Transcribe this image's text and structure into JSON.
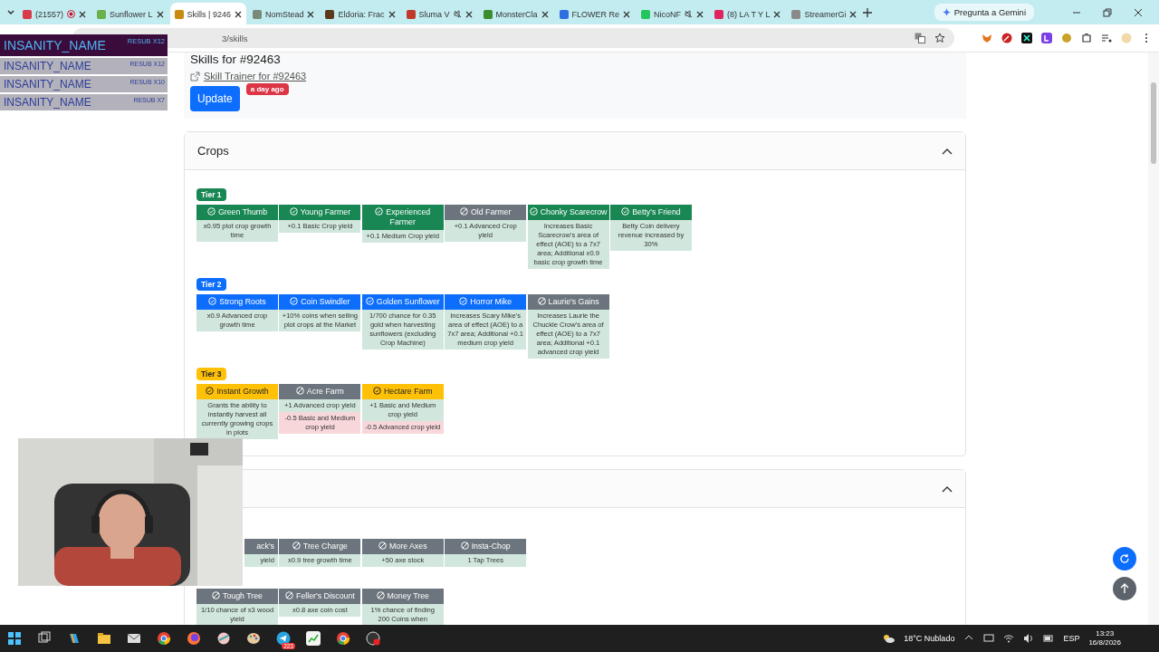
{
  "browser": {
    "tabs": [
      {
        "title": "(21557)",
        "selected": false,
        "color": "#d93a4a",
        "recording": true,
        "muted": false
      },
      {
        "title": "Sunflower L",
        "selected": false,
        "color": "#6ab04c",
        "recording": false,
        "muted": false
      },
      {
        "title": "Skills | 9246",
        "selected": true,
        "color": "#c98a10",
        "recording": false,
        "muted": false
      },
      {
        "title": "NomStead",
        "selected": false,
        "color": "#7a8a7a",
        "recording": false,
        "muted": false
      },
      {
        "title": "Eldoria: Frac",
        "selected": false,
        "color": "#5a3a1a",
        "recording": false,
        "muted": false
      },
      {
        "title": "Sluma V",
        "selected": false,
        "color": "#c0392b",
        "recording": false,
        "muted": true
      },
      {
        "title": "MonsterCla",
        "selected": false,
        "color": "#3c8d2f",
        "recording": false,
        "muted": false
      },
      {
        "title": "FLOWER Re",
        "selected": false,
        "color": "#2f6fe0",
        "recording": false,
        "muted": false
      },
      {
        "title": "NicoNF",
        "selected": false,
        "color": "#22c55e",
        "recording": false,
        "muted": true
      },
      {
        "title": "(8) LA T Y L",
        "selected": false,
        "color": "#e0245e",
        "recording": false,
        "muted": false
      },
      {
        "title": "StreamerGi",
        "selected": false,
        "color": "#8a8a8a",
        "recording": false,
        "muted": false
      }
    ],
    "gemini_button": "Pregunta a Gemini",
    "address": "3/skills"
  },
  "overlay": {
    "rows": [
      {
        "name": "INSANITY_NAME",
        "note": "RESUB X12",
        "highlighted": true
      },
      {
        "name": "INSANITY_NAME",
        "note": "RESUB X12",
        "highlighted": false
      },
      {
        "name": "INSANITY_NAME",
        "note": "RESUB X10",
        "highlighted": false
      },
      {
        "name": "INSANITY_NAME",
        "note": "RESUB X7",
        "highlighted": false
      }
    ]
  },
  "page": {
    "heading": "Skills for #92463",
    "trainer_link": "Skill Trainer for #92463",
    "update_button": "Update",
    "updated_badge": "a day ago",
    "sections": [
      {
        "title": "Crops",
        "expanded": true,
        "tiers": [
          {
            "label": "Tier 1",
            "color": "#198754",
            "skills": [
              {
                "name": "Green Thumb",
                "acquired": true,
                "effects": [
                  {
                    "text": "x0.95 plot crop growth time",
                    "kind": "buff"
                  }
                ]
              },
              {
                "name": "Young Farmer",
                "acquired": true,
                "effects": [
                  {
                    "text": "+0.1 Basic Crop yield",
                    "kind": "buff"
                  }
                ]
              },
              {
                "name": "Experienced Farmer",
                "acquired": true,
                "effects": [
                  {
                    "text": "+0.1 Medium Crop yield",
                    "kind": "buff"
                  }
                ]
              },
              {
                "name": "Old Farmer",
                "acquired": false,
                "effects": [
                  {
                    "text": "+0.1 Advanced Crop yield",
                    "kind": "buff"
                  }
                ]
              },
              {
                "name": "Chonky Scarecrow",
                "acquired": true,
                "effects": [
                  {
                    "text": "Increases Basic Scarecrow's area of effect (AOE) to a 7x7 area; Additional x0.9 basic crop growth time",
                    "kind": "buff"
                  }
                ]
              },
              {
                "name": "Betty's Friend",
                "acquired": true,
                "effects": [
                  {
                    "text": "Betty Coin delivery revenue increased by 30%",
                    "kind": "buff"
                  }
                ]
              }
            ]
          },
          {
            "label": "Tier 2",
            "color": "#0d6efd",
            "skills": [
              {
                "name": "Strong Roots",
                "acquired": true,
                "effects": [
                  {
                    "text": "x0.9 Advanced crop growth time",
                    "kind": "buff"
                  }
                ]
              },
              {
                "name": "Coin Swindler",
                "acquired": true,
                "effects": [
                  {
                    "text": "+10% coins when selling plot crops at the Market",
                    "kind": "buff"
                  }
                ]
              },
              {
                "name": "Golden Sunflower",
                "acquired": true,
                "effects": [
                  {
                    "text": "1/700 chance for 0.35 gold when harvesting sunflowers (excluding Crop Machine)",
                    "kind": "buff"
                  }
                ]
              },
              {
                "name": "Horror Mike",
                "acquired": true,
                "effects": [
                  {
                    "text": "Increases Scary Mike's area of effect (AOE) to a 7x7 area; Additional +0.1 medium crop yield",
                    "kind": "buff"
                  }
                ]
              },
              {
                "name": "Laurie's Gains",
                "acquired": false,
                "effects": [
                  {
                    "text": "Increases Laurie the Chuckle Crow's area of effect (AOE) to a 7x7 area; Additional +0.1 advanced crop yield",
                    "kind": "buff"
                  }
                ]
              }
            ]
          },
          {
            "label": "Tier 3",
            "color": "#ffc107",
            "skills": [
              {
                "name": "Instant Growth",
                "acquired": true,
                "effects": [
                  {
                    "text": "Grants the ability to instantly harvest all currently growing crops in plots",
                    "kind": "buff"
                  }
                ]
              },
              {
                "name": "Acre Farm",
                "acquired": false,
                "effects": [
                  {
                    "text": "+1 Advanced crop yield",
                    "kind": "buff"
                  },
                  {
                    "text": "-0.5 Basic and Medium crop yield",
                    "kind": "debuff"
                  }
                ]
              },
              {
                "name": "Hectare Farm",
                "acquired": true,
                "effects": [
                  {
                    "text": "+1 Basic and Medium crop yield",
                    "kind": "buff"
                  },
                  {
                    "text": "-0.5 Advanced crop yield",
                    "kind": "debuff"
                  }
                ]
              }
            ]
          }
        ]
      },
      {
        "expanded": true,
        "tiers": [
          {
            "skills": [
              {
                "name": "ack's",
                "acquired": false,
                "clipped": true,
                "effects": [
                  {
                    "text": "yield",
                    "kind": "buff"
                  }
                ]
              },
              {
                "name": "Tree Charge",
                "acquired": false,
                "effects": [
                  {
                    "text": "x0.9 tree growth time",
                    "kind": "buff"
                  }
                ]
              },
              {
                "name": "More Axes",
                "acquired": false,
                "effects": [
                  {
                    "text": "+50 axe stock",
                    "kind": "buff"
                  }
                ]
              },
              {
                "name": "Insta-Chop",
                "acquired": false,
                "effects": [
                  {
                    "text": "1 Tap Trees",
                    "kind": "buff"
                  }
                ]
              }
            ]
          },
          {
            "skills": [
              {
                "name": "Tough Tree",
                "acquired": false,
                "effects": [
                  {
                    "text": "1/10 chance of x3 wood yield",
                    "kind": "buff"
                  }
                ]
              },
              {
                "name": "Feller's Discount",
                "acquired": false,
                "effects": [
                  {
                    "text": "x0.8 axe coin cost",
                    "kind": "buff"
                  }
                ]
              },
              {
                "name": "Money Tree",
                "acquired": false,
                "effects": [
                  {
                    "text": "1% chance of finding 200 Coins when",
                    "kind": "buff"
                  }
                ]
              }
            ]
          }
        ]
      }
    ]
  },
  "taskbar": {
    "telegram_badge": "223",
    "weather": "18°C Nublado",
    "language": "ESP",
    "time": "13:23",
    "date": "16/8/2026"
  }
}
